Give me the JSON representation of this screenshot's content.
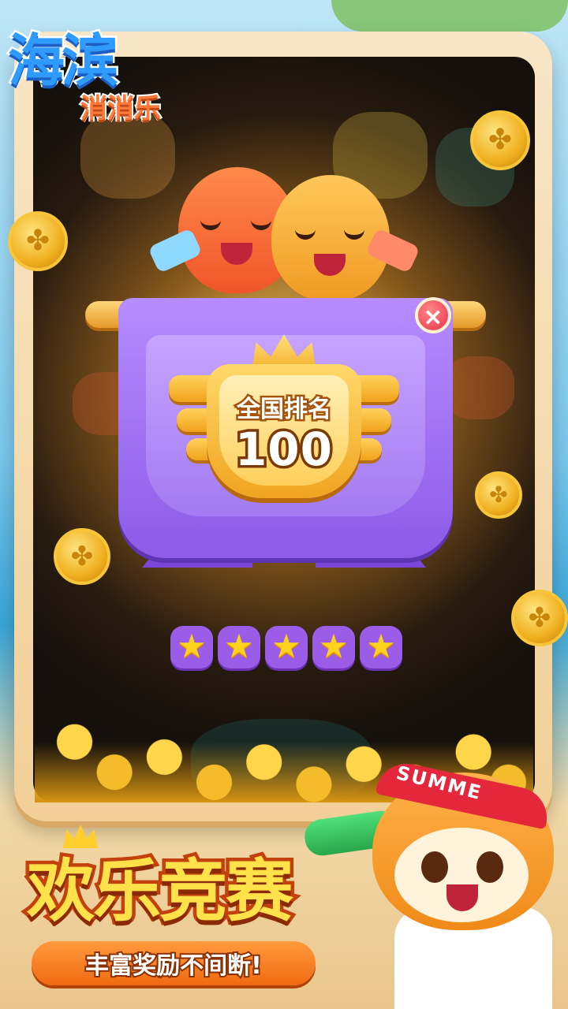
{
  "logo": {
    "line1": "海滨",
    "line2": "消消乐"
  },
  "popup": {
    "close_icon": "×",
    "rank_label": "全国排名",
    "rank_value": "100",
    "stars": {
      "value": 5,
      "max": 5
    }
  },
  "headband": "SUMME",
  "promo": {
    "title": "欢乐竞赛",
    "subtitle": "丰富奖励不间断!"
  },
  "colors": {
    "banner_purple": "#8c5be8",
    "badge_gold": "#f0a420",
    "title_yellow": "#ffe24a",
    "close_red": "#e8314a"
  }
}
